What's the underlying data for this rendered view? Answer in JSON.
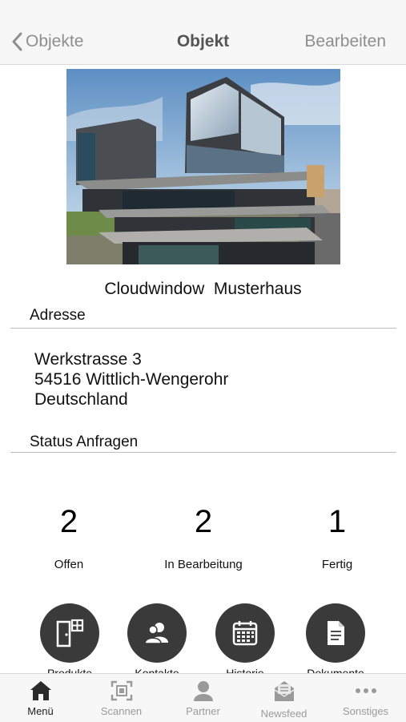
{
  "nav": {
    "back_label": "Objekte",
    "title": "Objekt",
    "edit_label": "Bearbeiten"
  },
  "object": {
    "name": "Cloudwindow  Musterhaus",
    "photo_icon": "building-photo"
  },
  "address": {
    "section_label": "Adresse",
    "line1": "Werkstrasse 3",
    "line2": "54516 Wittlich-Wengerohr",
    "line3": "Deutschland"
  },
  "status": {
    "section_label": "Status Anfragen",
    "items": [
      {
        "count": "2",
        "label": "Offen"
      },
      {
        "count": "2",
        "label": "In Bearbeitung"
      },
      {
        "count": "1",
        "label": "Fertig"
      }
    ]
  },
  "actions": [
    {
      "label": "Produkte",
      "icon": "door-window-icon"
    },
    {
      "label": "Kontakte",
      "icon": "contacts-icon"
    },
    {
      "label": "Historie",
      "icon": "calendar-icon"
    },
    {
      "label": "Dokumente",
      "icon": "document-icon"
    }
  ],
  "tabbar": {
    "items": [
      {
        "label": "Menü",
        "icon": "home-icon",
        "active": true
      },
      {
        "label": "Scannen",
        "icon": "scan-icon",
        "active": false
      },
      {
        "label": "Partner",
        "icon": "partner-icon",
        "active": false
      },
      {
        "label": "Newsfeed",
        "icon": "mail-icon",
        "active": false
      },
      {
        "label": "Sonstiges",
        "icon": "more-icon",
        "active": false
      }
    ]
  },
  "colors": {
    "action_circle": "#3a3a3a",
    "nav_text": "#8e8e8e",
    "tab_inactive": "#9a9a9a",
    "tab_active": "#222222"
  }
}
